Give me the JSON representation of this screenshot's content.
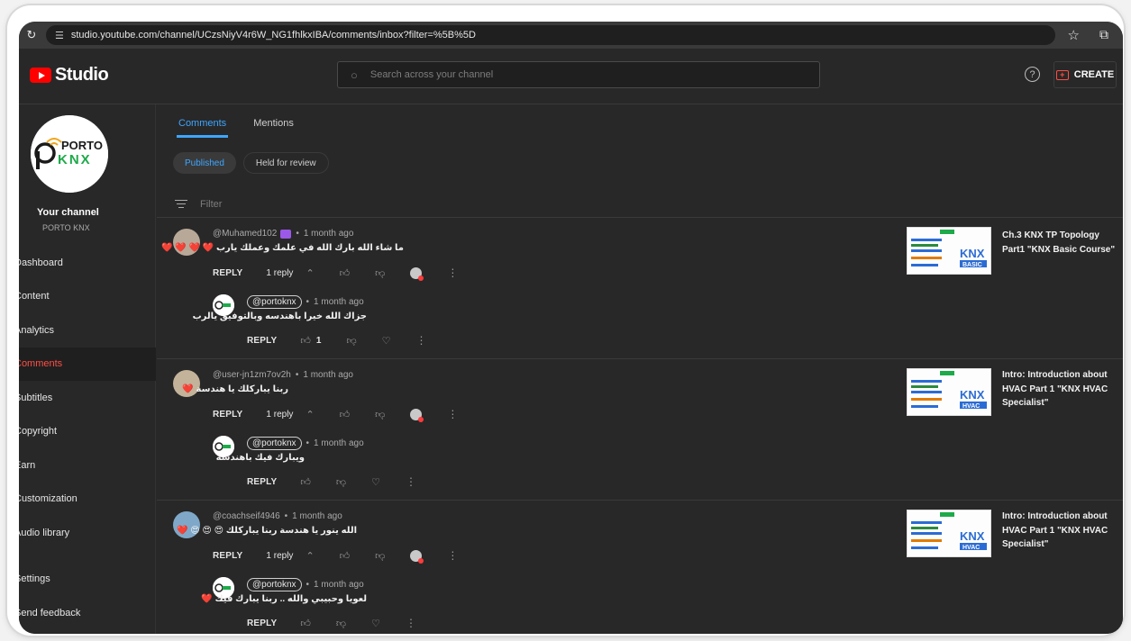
{
  "browser": {
    "url": "studio.youtube.com/channel/UCzsNiyV4r6W_NG1fhlkxIBA/comments/inbox?filter=%5B%5D"
  },
  "header": {
    "logo_text": "Studio",
    "search_placeholder": "Search across your channel",
    "create_label": "CREATE"
  },
  "sidebar": {
    "channel_title": "Your channel",
    "channel_name": "PORTO KNX",
    "logo_top": "PORTO",
    "logo_bottom": "KNX",
    "items": [
      {
        "label": "Dashboard"
      },
      {
        "label": "Content"
      },
      {
        "label": "Analytics"
      },
      {
        "label": "Comments"
      },
      {
        "label": "Subtitles"
      },
      {
        "label": "Copyright"
      },
      {
        "label": "Earn"
      },
      {
        "label": "Customization"
      },
      {
        "label": "Audio library"
      },
      {
        "label": "Settings"
      },
      {
        "label": "Send feedback"
      }
    ]
  },
  "main": {
    "tabs": [
      {
        "label": "Comments"
      },
      {
        "label": "Mentions"
      }
    ],
    "filters": [
      {
        "label": "Published"
      },
      {
        "label": "Held for review"
      }
    ],
    "filter_label": "Filter",
    "reply_label": "REPLY",
    "threads": [
      {
        "author": "@Muhamed102",
        "time": "1 month ago",
        "text": "ما شاء الله بارك الله في علمك وعملك يارب ❤️ ❤️ ❤️ ❤️",
        "replies": "1 reply",
        "reply": {
          "author": "@portoknx",
          "time": "1 month ago",
          "text": "جزاك الله خيرا باهندسه وبالتوفيق يالرب",
          "likes": "1"
        },
        "video_title": "Ch.3 KNX TP Topology Part1 \"KNX Basic Course\"",
        "thumb_tag": "BASIC"
      },
      {
        "author": "@user-jn1zm7ov2h",
        "time": "1 month ago",
        "text": "ربنا يباركلك يا هندسة ❤️",
        "replies": "1 reply",
        "reply": {
          "author": "@portoknx",
          "time": "1 month ago",
          "text": "ويبارك فيك باهندسة",
          "likes": ""
        },
        "video_title": "Intro: Introduction about HVAC Part 1 \"KNX HVAC Specialist\"",
        "thumb_tag": "HVAC"
      },
      {
        "author": "@coachseif4946",
        "time": "1 month ago",
        "text": "الله ينور يا هندسة ربنا يباركلك 😍 😍 😍 ❤️",
        "replies": "1 reply",
        "reply": {
          "author": "@portoknx",
          "time": "1 month ago",
          "text": "لعويا وحبيبي والله .. ربنا يبارك فيك ❤️",
          "likes": ""
        },
        "video_title": "Intro: Introduction about HVAC Part 1 \"KNX HVAC Specialist\"",
        "thumb_tag": "HVAC"
      }
    ]
  },
  "colors": {
    "accent_blue": "#3ea6ff",
    "active_nav": "#ff4e45",
    "background": "#282828"
  }
}
